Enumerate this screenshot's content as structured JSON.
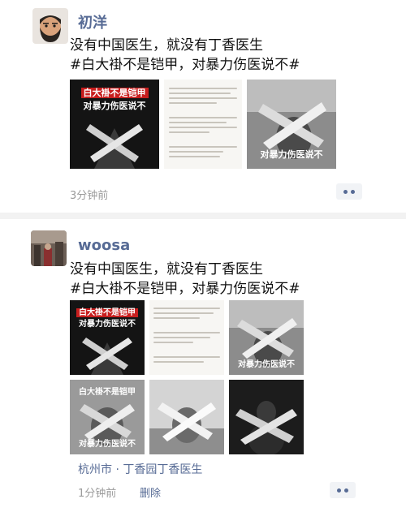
{
  "posts": [
    {
      "author": "初洋",
      "avatar": "cartoon-bearded-man-avatar",
      "content_line1": "没有中国医生，就没有丁香医生",
      "content_line2": "#白大褂不是铠甲，对暴力伤医说不#",
      "image_captions": {
        "red_banner": "白大褂不是铠甲",
        "subtitle": "对暴力伤医说不",
        "photo_caption": "对暴力伤医说不"
      },
      "time": "3分钟前"
    },
    {
      "author": "woosa",
      "avatar": "street-photo-avatar",
      "content_line1": "没有中国医生，就没有丁香医生",
      "content_line2": "#白大褂不是铠甲，对暴力伤医说不#",
      "image_captions": {
        "red_banner": "白大褂不是铠甲",
        "subtitle": "对暴力伤医说不",
        "photo_caption": "对暴力伤医说不",
        "tile4_top": "白大褂不是铠甲",
        "tile4_bottom": "对暴力伤医说不"
      },
      "location": "杭州市 · 丁香园丁香医生",
      "time": "1分钟前",
      "delete_label": "删除"
    }
  ],
  "colors": {
    "link_blue": "#576b95",
    "banner_red": "#c81e1e",
    "time_gray": "#9a9a9a"
  }
}
